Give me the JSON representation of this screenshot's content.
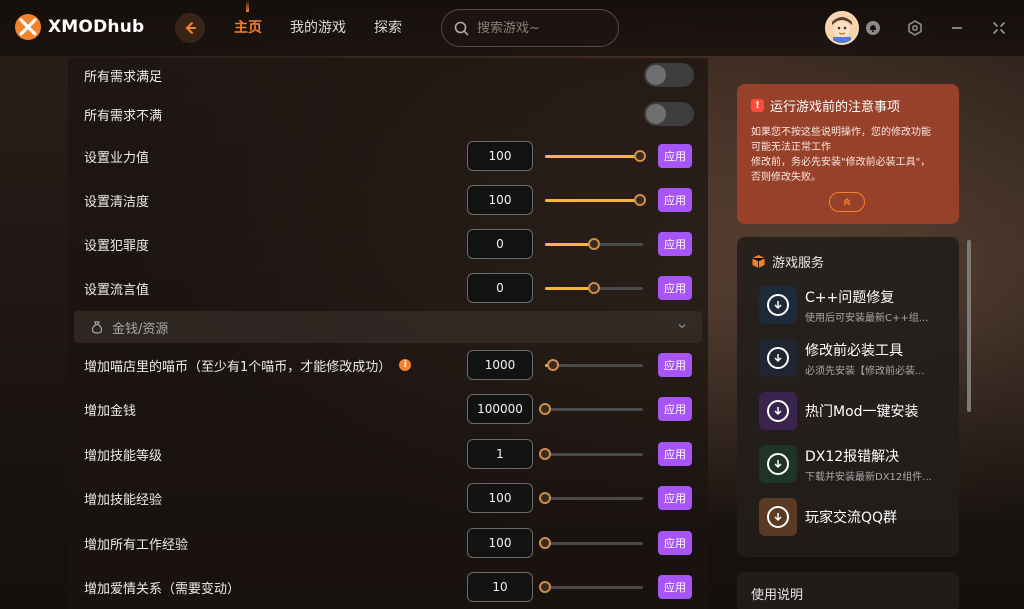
{
  "app": {
    "logo_main": "XMOD",
    "logo_sub": "hub"
  },
  "nav": {
    "items": [
      {
        "label": "主页",
        "active": true
      },
      {
        "label": "我的游戏",
        "active": false
      },
      {
        "label": "探索",
        "active": false
      }
    ]
  },
  "search": {
    "placeholder": "搜索游戏~"
  },
  "colors": {
    "accent": "#f5822b",
    "apply_button": "#a855f7",
    "slider_fill": "#f5b541",
    "notice_bg": "#97402a"
  },
  "toggles": [
    {
      "label": "所有需求满足",
      "on": false
    },
    {
      "label": "所有需求不满",
      "on": false
    }
  ],
  "sliders_top": [
    {
      "label": "设置业力值",
      "value": "100",
      "level": 0.97
    },
    {
      "label": "设置清洁度",
      "value": "100",
      "level": 0.97
    },
    {
      "label": "设置犯罪度",
      "value": "0",
      "level": 0.5
    },
    {
      "label": "设置流言值",
      "value": "0",
      "level": 0.5
    }
  ],
  "section": {
    "title": "金钱/资源",
    "icon": "money-bag-icon"
  },
  "sliders_money": [
    {
      "label": "增加喵店里的喵币（至少有1个喵币，才能修改成功）",
      "value": "1000",
      "level": 0.08,
      "info": true
    },
    {
      "label": "增加金钱",
      "value": "100000",
      "level": 0.0
    },
    {
      "label": "增加技能等级",
      "value": "1",
      "level": 0.0
    },
    {
      "label": "增加技能经验",
      "value": "100",
      "level": 0.0
    },
    {
      "label": "增加所有工作经验",
      "value": "100",
      "level": 0.0
    },
    {
      "label": "增加爱情关系（需要变动）",
      "value": "10",
      "level": 0.0
    }
  ],
  "apply_label": "应用",
  "notice": {
    "title": "运行游戏前的注意事项",
    "line1": "如果您不按这些说明操作，您的修改功能",
    "line2": "可能无法正常工作",
    "line3": "修改前，务必先安装\"修改前必装工具\"，",
    "line4": "否则修改失败。"
  },
  "services": {
    "title": "游戏服务",
    "items": [
      {
        "title": "C++问题修复",
        "desc": "使用后可安装最新C++组...",
        "color": "#1d2a3a"
      },
      {
        "title": "修改前必装工具",
        "desc": "必须先安装【修改前必装...",
        "color": "#1f2533"
      },
      {
        "title": "热门Mod一键安装",
        "desc": "",
        "color": "#3b2350"
      },
      {
        "title": "DX12报错解决",
        "desc": "下载并安装最新DX12组件...",
        "color": "#1f3328"
      },
      {
        "title": "玩家交流QQ群",
        "desc": "",
        "color": "#5a3a22"
      }
    ]
  },
  "usage": {
    "title": "使用说明"
  }
}
